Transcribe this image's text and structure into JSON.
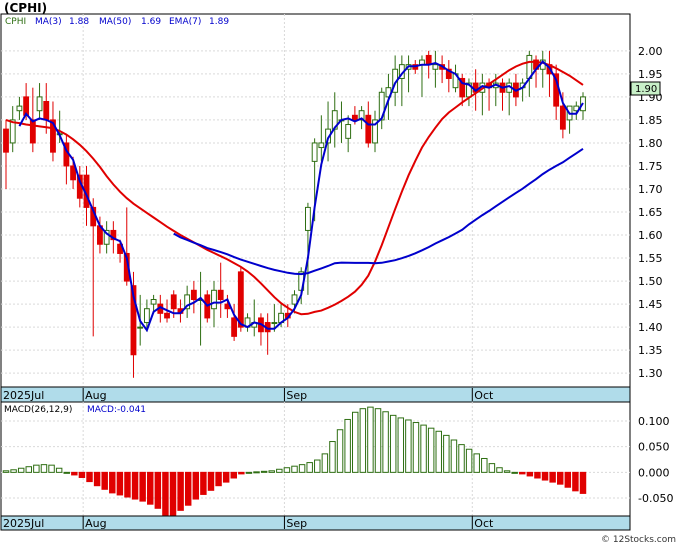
{
  "title": "(CPHI)",
  "legend": {
    "ticker": "CPHI",
    "ma_short": "MA(3)",
    "ma_short_value": "1.88",
    "ma_long": "MA(50)",
    "ma_long_value": "1.69",
    "ema": "EMA(7)",
    "ema_value": "1.89"
  },
  "last_price_label": "1.90",
  "macd_legend": {
    "params": "MACD(26,12,9)",
    "value": "MACD:-0.041"
  },
  "watermark": "© 12Stocks.com",
  "colors": {
    "up_candle": "#2e6e12",
    "down_candle": "#e00000",
    "ema_line": "#e00000",
    "ma_line": "#0000cc",
    "date_strip": "#b0dcea",
    "price_tag": "#c8f0c8"
  },
  "chart_data": [
    {
      "type": "candlestick",
      "name": "price",
      "date_labels": [
        "2025Jul",
        "Aug",
        "Sep",
        "Oct"
      ],
      "date_label_bar_index": [
        0,
        12,
        42,
        70
      ],
      "ylim": [
        1.27,
        2.08
      ],
      "yticks": [
        "2.00",
        "1.95",
        "1.90",
        "1.85",
        "1.80",
        "1.75",
        "1.70",
        "1.65",
        "1.60",
        "1.55",
        "1.50",
        "1.45",
        "1.40",
        "1.35",
        "1.30"
      ],
      "grid": true,
      "ohlc": [
        [
          1.83,
          1.85,
          1.7,
          1.78
        ],
        [
          1.8,
          1.88,
          1.78,
          1.85
        ],
        [
          1.87,
          1.9,
          1.85,
          1.88
        ],
        [
          1.9,
          1.93,
          1.85,
          1.86
        ],
        [
          1.85,
          1.92,
          1.78,
          1.8
        ],
        [
          1.87,
          1.93,
          1.85,
          1.9
        ],
        [
          1.89,
          1.93,
          1.82,
          1.85
        ],
        [
          1.85,
          1.89,
          1.76,
          1.78
        ],
        [
          1.82,
          1.87,
          1.8,
          1.82
        ],
        [
          1.8,
          1.82,
          1.71,
          1.75
        ],
        [
          1.75,
          1.77,
          1.7,
          1.72
        ],
        [
          1.73,
          1.75,
          1.66,
          1.68
        ],
        [
          1.73,
          1.75,
          1.62,
          1.66
        ],
        [
          1.66,
          1.68,
          1.38,
          1.62
        ],
        [
          1.62,
          1.64,
          1.56,
          1.58
        ],
        [
          1.58,
          1.63,
          1.56,
          1.61
        ],
        [
          1.61,
          1.63,
          1.56,
          1.59
        ],
        [
          1.58,
          1.59,
          1.54,
          1.56
        ],
        [
          1.56,
          1.66,
          1.49,
          1.5
        ],
        [
          1.49,
          1.52,
          1.29,
          1.34
        ],
        [
          1.4,
          1.47,
          1.36,
          1.4
        ],
        [
          1.41,
          1.46,
          1.39,
          1.44
        ],
        [
          1.45,
          1.47,
          1.43,
          1.46
        ],
        [
          1.45,
          1.47,
          1.41,
          1.43
        ],
        [
          1.43,
          1.46,
          1.41,
          1.42
        ],
        [
          1.47,
          1.48,
          1.42,
          1.44
        ],
        [
          1.44,
          1.46,
          1.41,
          1.43
        ],
        [
          1.44,
          1.49,
          1.42,
          1.47
        ],
        [
          1.48,
          1.5,
          1.43,
          1.46
        ],
        [
          1.46,
          1.52,
          1.36,
          1.46
        ],
        [
          1.47,
          1.48,
          1.41,
          1.42
        ],
        [
          1.44,
          1.5,
          1.4,
          1.48
        ],
        [
          1.48,
          1.54,
          1.42,
          1.46
        ],
        [
          1.45,
          1.47,
          1.42,
          1.44
        ],
        [
          1.42,
          1.45,
          1.37,
          1.38
        ],
        [
          1.52,
          1.53,
          1.39,
          1.4
        ],
        [
          1.4,
          1.43,
          1.39,
          1.42
        ],
        [
          1.4,
          1.46,
          1.38,
          1.41
        ],
        [
          1.42,
          1.43,
          1.36,
          1.39
        ],
        [
          1.41,
          1.43,
          1.34,
          1.39
        ],
        [
          1.41,
          1.45,
          1.39,
          1.41
        ],
        [
          1.41,
          1.45,
          1.4,
          1.43
        ],
        [
          1.43,
          1.45,
          1.4,
          1.42
        ],
        [
          1.45,
          1.48,
          1.43,
          1.47
        ],
        [
          1.48,
          1.53,
          1.45,
          1.52
        ],
        [
          1.61,
          1.67,
          1.47,
          1.66
        ],
        [
          1.76,
          1.81,
          1.63,
          1.8
        ],
        [
          1.79,
          1.86,
          1.76,
          1.8
        ],
        [
          1.8,
          1.89,
          1.76,
          1.83
        ],
        [
          1.83,
          1.91,
          1.79,
          1.87
        ],
        [
          1.85,
          1.89,
          1.8,
          1.85
        ],
        [
          1.81,
          1.86,
          1.78,
          1.84
        ],
        [
          1.86,
          1.88,
          1.84,
          1.85
        ],
        [
          1.85,
          1.88,
          1.83,
          1.87
        ],
        [
          1.86,
          1.89,
          1.79,
          1.8
        ],
        [
          1.8,
          1.87,
          1.78,
          1.85
        ],
        [
          1.85,
          1.92,
          1.83,
          1.91
        ],
        [
          1.9,
          1.95,
          1.85,
          1.92
        ],
        [
          1.91,
          1.99,
          1.88,
          1.96
        ],
        [
          1.94,
          1.99,
          1.88,
          1.97
        ],
        [
          1.96,
          1.99,
          1.91,
          1.97
        ],
        [
          1.97,
          1.98,
          1.95,
          1.96
        ],
        [
          1.97,
          1.99,
          1.9,
          1.98
        ],
        [
          1.99,
          2.0,
          1.94,
          1.97
        ],
        [
          1.96,
          2.0,
          1.92,
          1.97
        ],
        [
          1.97,
          1.99,
          1.93,
          1.96
        ],
        [
          1.96,
          1.98,
          1.91,
          1.94
        ],
        [
          1.92,
          1.97,
          1.91,
          1.95
        ],
        [
          1.94,
          1.95,
          1.88,
          1.9
        ],
        [
          1.9,
          1.94,
          1.88,
          1.93
        ],
        [
          1.93,
          1.96,
          1.87,
          1.91
        ],
        [
          1.91,
          1.95,
          1.86,
          1.93
        ],
        [
          1.93,
          1.94,
          1.87,
          1.92
        ],
        [
          1.92,
          1.95,
          1.88,
          1.93
        ],
        [
          1.93,
          1.94,
          1.87,
          1.91
        ],
        [
          1.91,
          1.94,
          1.86,
          1.93
        ],
        [
          1.93,
          1.95,
          1.88,
          1.9
        ],
        [
          1.92,
          1.94,
          1.89,
          1.93
        ],
        [
          1.94,
          2.0,
          1.9,
          1.99
        ],
        [
          1.98,
          1.99,
          1.92,
          1.96
        ],
        [
          1.96,
          2.0,
          1.92,
          1.98
        ],
        [
          1.97,
          2.0,
          1.9,
          1.95
        ],
        [
          1.95,
          1.97,
          1.85,
          1.88
        ],
        [
          1.88,
          1.91,
          1.81,
          1.83
        ],
        [
          1.85,
          1.88,
          1.82,
          1.88
        ],
        [
          1.87,
          1.89,
          1.85,
          1.88
        ],
        [
          1.87,
          1.91,
          1.85,
          1.9
        ]
      ],
      "series": [
        {
          "name": "EMA(7)",
          "values": [
            1.85,
            1.845,
            1.843,
            1.84,
            1.838,
            1.836,
            1.834,
            1.832,
            1.826,
            1.818,
            1.808,
            1.796,
            1.782,
            1.766,
            1.748,
            1.728,
            1.71,
            1.694,
            1.68,
            1.668,
            1.658,
            1.648,
            1.638,
            1.628,
            1.618,
            1.609,
            1.6,
            1.592,
            1.584,
            1.576,
            1.568,
            1.561,
            1.554,
            1.547,
            1.539,
            1.531,
            1.521,
            1.509,
            1.495,
            1.48,
            1.465,
            1.452,
            1.442,
            1.433,
            1.428,
            1.429,
            1.433,
            1.436,
            1.442,
            1.449,
            1.457,
            1.466,
            1.477,
            1.492,
            1.512,
            1.542,
            1.578,
            1.617,
            1.656,
            1.694,
            1.73,
            1.761,
            1.79,
            1.813,
            1.833,
            1.852,
            1.866,
            1.877,
            1.888,
            1.898,
            1.908,
            1.918,
            1.928,
            1.938,
            1.948,
            1.958,
            1.966,
            1.972,
            1.976,
            1.976,
            1.974,
            1.969,
            1.962,
            1.954,
            1.946,
            1.936,
            1.926,
            1.917,
            1.909,
            1.903,
            1.897,
            1.891,
            1.886,
            1.882,
            1.876,
            1.868,
            1.859,
            1.854,
            1.854
          ]
        },
        {
          "name": "MA(3)",
          "values": [
            null,
            null,
            null,
            null,
            null,
            null,
            null,
            null,
            null,
            null,
            null,
            null,
            null,
            null,
            null,
            null,
            null,
            null,
            null,
            null,
            null,
            null,
            null,
            null,
            null,
            null,
            null,
            null,
            null,
            null,
            null,
            null,
            null,
            null,
            null,
            null,
            null,
            null,
            null,
            null,
            null,
            null,
            null,
            null,
            null,
            null,
            null,
            null,
            null,
            null,
            null,
            null,
            null,
            null,
            null,
            null,
            null,
            null,
            null,
            null,
            null,
            null,
            null,
            null,
            null,
            null,
            null,
            null,
            null,
            null,
            null,
            null,
            null,
            null,
            null,
            null,
            null,
            null,
            null,
            null,
            null,
            null,
            null,
            null,
            null,
            null,
            null,
            null,
            null
          ]
        }
      ]
    },
    {
      "type": "bar",
      "name": "macd",
      "date_labels": [
        "2025Jul",
        "Aug",
        "Sep",
        "Oct"
      ],
      "ylim": [
        -0.085,
        0.137
      ],
      "yticks": [
        "0.100",
        "0.050",
        "0.000",
        "-0.050"
      ],
      "grid": true,
      "values": [
        0.003,
        0.005,
        0.008,
        0.011,
        0.014,
        0.015,
        0.014,
        0.008,
        0.0,
        -0.005,
        -0.01,
        -0.018,
        -0.026,
        -0.033,
        -0.04,
        -0.044,
        -0.048,
        -0.052,
        -0.056,
        -0.062,
        -0.07,
        -0.083,
        -0.085,
        -0.074,
        -0.064,
        -0.052,
        -0.043,
        -0.035,
        -0.026,
        -0.019,
        -0.011,
        -0.003,
        0.0,
        0.001,
        0.002,
        0.003,
        0.006,
        0.009,
        0.012,
        0.015,
        0.019,
        0.024,
        0.036,
        0.06,
        0.083,
        0.103,
        0.117,
        0.124,
        0.127,
        0.124,
        0.118,
        0.111,
        0.106,
        0.102,
        0.097,
        0.092,
        0.086,
        0.08,
        0.072,
        0.063,
        0.054,
        0.045,
        0.036,
        0.027,
        0.017,
        0.009,
        0.003,
        0.0,
        -0.003,
        -0.007,
        -0.011,
        -0.015,
        -0.019,
        -0.023,
        -0.029,
        -0.036,
        -0.041
      ]
    }
  ]
}
